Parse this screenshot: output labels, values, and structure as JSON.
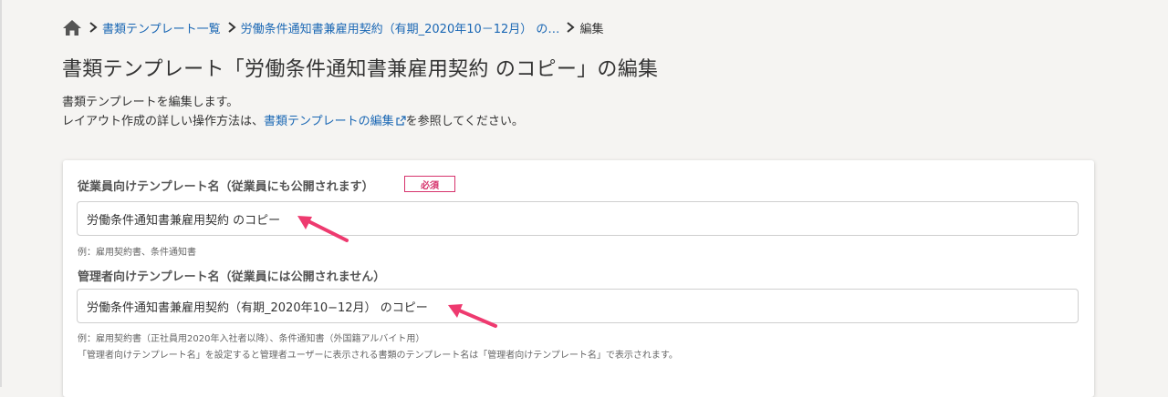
{
  "breadcrumb": {
    "home_icon": "home-icon",
    "items": [
      "書類テンプレート一覧",
      "労働条件通知書兼雇用契約（有期_2020年10－12月） の…",
      "編集"
    ]
  },
  "page_title": "書類テンプレート「労働条件通知書兼雇用契約 のコピー」の編集",
  "description": {
    "line1": "書類テンプレートを編集します。",
    "line2_prefix": "レイアウト作成の詳しい操作方法は、",
    "line2_link": "書類テンプレートの編集",
    "line2_suffix": "を参照してください。"
  },
  "form": {
    "employee_name": {
      "label": "従業員向けテンプレート名（従業員にも公開されます）",
      "required_badge": "必須",
      "value": "労働条件通知書兼雇用契約 のコピー",
      "hint": "例：雇用契約書、条件通知書"
    },
    "admin_name": {
      "label": "管理者向けテンプレート名（従業員には公開されません）",
      "value": "労働条件通知書兼雇用契約（有期_2020年10−12月） のコピー",
      "hint1": "例：雇用契約書（正社員用2020年入社者以降）、条件通知書（外国籍アルバイト用）",
      "hint2": "「管理者向けテンプレート名」を設定すると管理者ユーザーに表示される書類のテンプレート名は「管理者向けテンプレート名」で表示されます。"
    }
  },
  "colors": {
    "link": "#1a67b4",
    "required": "#d6336c",
    "annotation_arrow": "#ee3a6f"
  }
}
